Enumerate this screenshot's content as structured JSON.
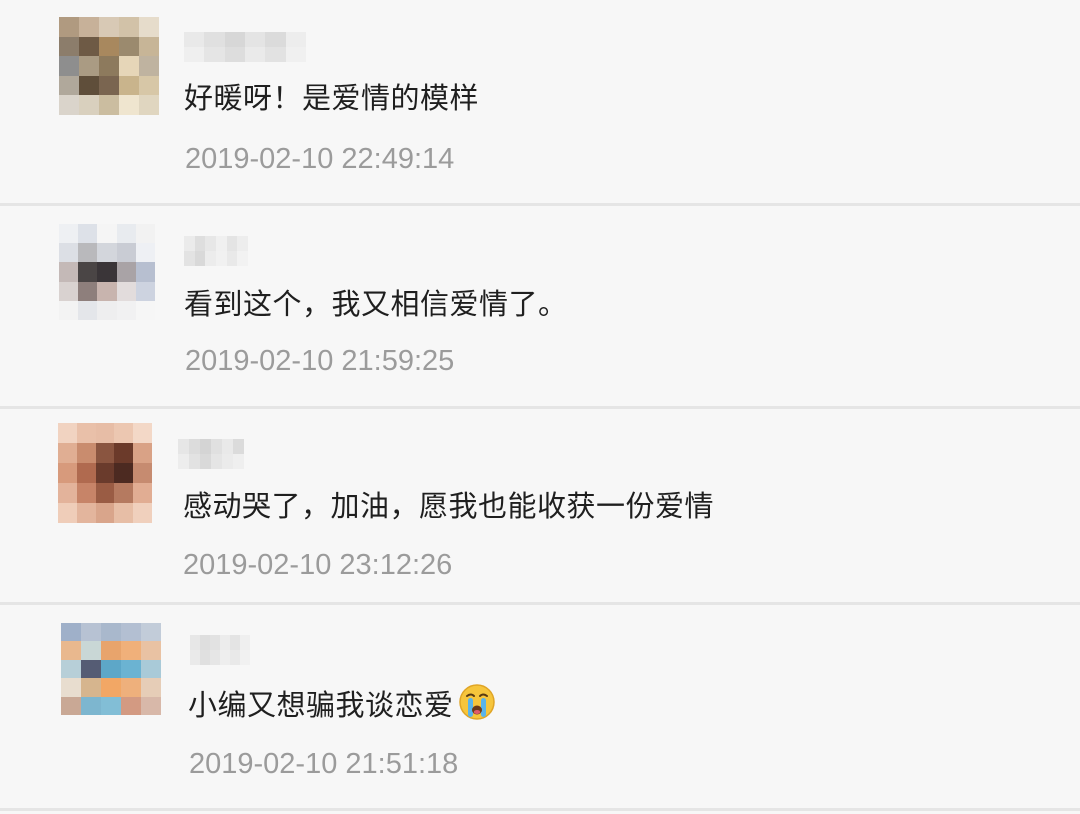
{
  "comments": [
    {
      "text": "好暖呀！是爱情的模样",
      "time": "2019-02-10 22:49:14",
      "avatar_colors": [
        "#b09a80",
        "#c7b199",
        "#d8c9b5",
        "#d2c2a8",
        "#e6dccb",
        "#8c7d6b",
        "#6e5a45",
        "#a8885e",
        "#9b8a6e",
        "#c7b597",
        "#8e8e8e",
        "#aa9b83",
        "#8d7a5d",
        "#e6d6b8",
        "#bfb3a0",
        "#b0a89b",
        "#5f4e3a",
        "#7a6550",
        "#c9b48c",
        "#d7c7a7",
        "#dad4cb",
        "#d9d0be",
        "#cbbda0",
        "#efe5cf",
        "#e0d6c0"
      ],
      "nick_colors": [
        "#e8e8e8",
        "#dedede",
        "#d4d4d4",
        "#e2e2e2",
        "#d9d9d9",
        "#ececec",
        "#efefef",
        "#e4e4e4",
        "#dbdbdb",
        "#e9e9e9",
        "#e0e0e0",
        "#f0f0f0"
      ]
    },
    {
      "text": "看到这个，我又相信爱情了。",
      "time": "2019-02-10 21:59:25",
      "avatar_colors": [
        "#eef0f3",
        "#dde1e8",
        "#f5f5f5",
        "#e8ebef",
        "#f2f2f2",
        "#dcdfe5",
        "#b9b9bc",
        "#d3d6dc",
        "#c9ccd4",
        "#eef0f4",
        "#c4b9b7",
        "#4a4545",
        "#3a3538",
        "#a9a3a6",
        "#b7bfd0",
        "#d9d2d0",
        "#8e7f7c",
        "#c8b4ae",
        "#e2dcdc",
        "#cdd3e0",
        "#f3f3f3",
        "#e4e6ea",
        "#eeeeef",
        "#f1f1f2",
        "#f6f6f6"
      ],
      "nick_colors": [
        "#eaeaea",
        "#dcdcdc",
        "#e6e6e6",
        "#f0f0f0",
        "#e3e3e3",
        "#ededed",
        "#e1e1e1",
        "#d6d6d6",
        "#ebebeb",
        "#f1f1f1",
        "#e8e8e8",
        "#f2f2f2"
      ]
    },
    {
      "text": "感动哭了，加油，愿我也能收获一份爱情",
      "time": "2019-02-10 23:12:26",
      "avatar_colors": [
        "#f1d3c1",
        "#e9c0a9",
        "#e7bda6",
        "#ecc7b1",
        "#f3d8c7",
        "#e0ae93",
        "#c98c6e",
        "#8a5540",
        "#6b3a2a",
        "#d9a286",
        "#d79a7c",
        "#b06a4f",
        "#6a3b2c",
        "#4c2a21",
        "#c68b70",
        "#e3b39b",
        "#c78468",
        "#9a5c44",
        "#b57a60",
        "#e1ad93",
        "#efcdb9",
        "#e3b59d",
        "#d9a58b",
        "#e7bea6",
        "#f0d0bd"
      ],
      "nick_colors": [
        "#e5e5e5",
        "#dadada",
        "#d1d1d1",
        "#dedede",
        "#e8e8e8",
        "#d8d8d8",
        "#ececec",
        "#e0e0e0",
        "#d6d6d6",
        "#e4e4e4",
        "#eaeaea",
        "#efefef"
      ]
    },
    {
      "text": "小编又想骗我谈恋爱",
      "time": "2019-02-10 21:51:18",
      "avatar_colors": [
        "#9fb0c9",
        "#b7c2d3",
        "#a9b8cc",
        "#b3bfd2",
        "#c2ccd9",
        "#e9b88e",
        "#c9d7d6",
        "#e8a46c",
        "#f0b07a",
        "#e9c2a3",
        "#b7cfd8",
        "#555c74",
        "#5da7c8",
        "#6bb3d2",
        "#a9cad8",
        "#e8ddcf",
        "#d6b58e",
        "#f2a765",
        "#eeb07c",
        "#e6cdb7",
        "#c9a895",
        "#7db6cf",
        "#82bed6",
        "#d39a82",
        "#d8b8a9"
      ],
      "nick_colors": [
        "#e6e6e6",
        "#dcdcdc",
        "#e0e0e0",
        "#ebebeb",
        "#e3e3e3",
        "#efefef",
        "#e9e9e9",
        "#dedede",
        "#e5e5e5",
        "#eeeeee",
        "#e8e8e8",
        "#f1f1f1"
      ]
    }
  ],
  "emoji_name": "crying-face-emoji",
  "colors": {
    "background": "#f7f7f7",
    "divider": "#e5e5e5",
    "comment_text": "#1f1f1f",
    "timestamp": "#9b9b9b"
  }
}
